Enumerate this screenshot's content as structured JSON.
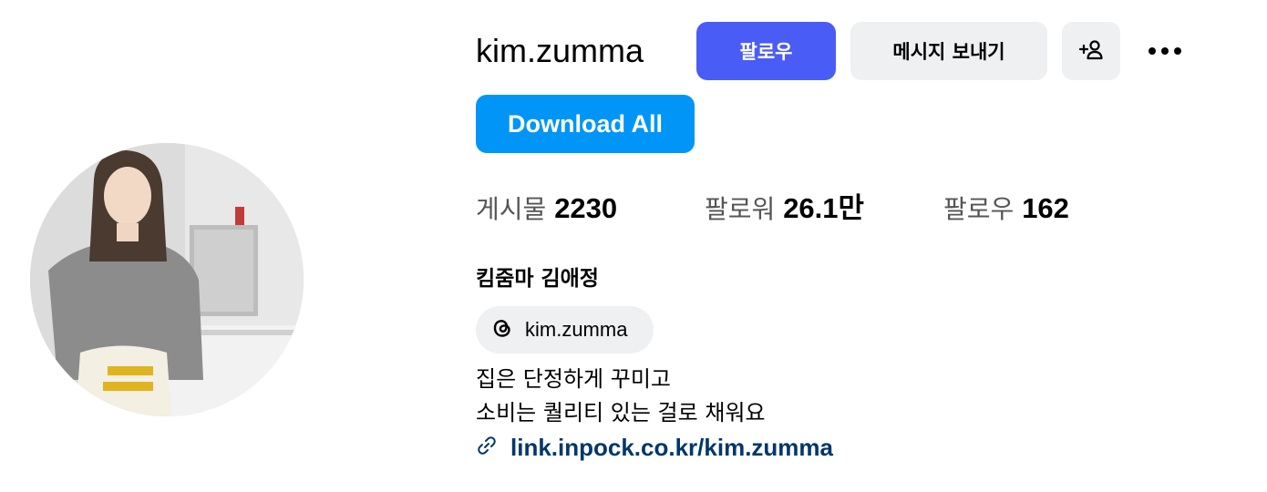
{
  "profile": {
    "username": "kim.zumma",
    "full_name": "킴줌마 김애정",
    "bio_lines": [
      "집은 단정하게 꾸미고",
      "소비는 퀄리티 있는 걸로 채워요"
    ],
    "link": "link.inpock.co.kr/kim.zumma",
    "threads_handle": "kim.zumma"
  },
  "buttons": {
    "follow": "팔로우",
    "message": "메시지 보내기",
    "download_all": "Download All"
  },
  "stats": {
    "posts_label": "게시물",
    "posts_value": "2230",
    "followers_label": "팔로워",
    "followers_value": "26.1만",
    "following_label": "팔로우",
    "following_value": "162"
  },
  "icons": {
    "add_user": "add-user-icon",
    "more": "more-options-icon",
    "threads": "threads-icon",
    "link": "link-icon"
  },
  "colors": {
    "follow_button": "#4a5cf6",
    "download_button": "#0095f6",
    "secondary_button": "#eff0f2",
    "link_text": "#00376b"
  }
}
